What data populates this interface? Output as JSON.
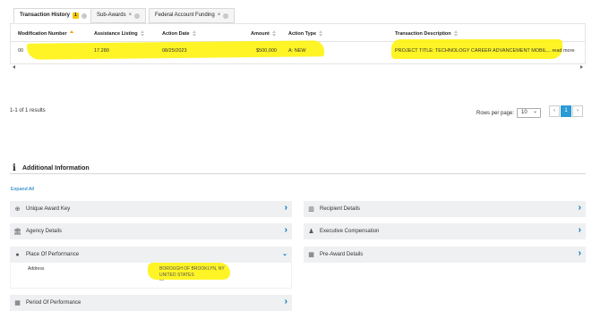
{
  "tabs": [
    {
      "label": "Transaction History",
      "badge": "1",
      "active": true
    },
    {
      "label": "Sub-Awards",
      "close": "×"
    },
    {
      "label": "Federal Account Funding",
      "close": "×"
    }
  ],
  "table": {
    "headers": [
      "Modification Number",
      "Assistance Listing",
      "Action Date",
      "Amount",
      "Action Type",
      "Transaction Description"
    ],
    "row": {
      "modification_number": "00",
      "assistance_listing": "17.280",
      "action_date": "08/25/2023",
      "amount": "$500,000",
      "action_type": "A: NEW",
      "description": "PROJECT TITLE: TECHNOLOGY CAREER ADVANCEMENT MOBIL...",
      "read_more": "read more"
    }
  },
  "pagination": {
    "results_text": "1-1 of 1 results",
    "rows_per_page_label": "Rows per page:",
    "rows_per_page_value": "10",
    "prev": "‹",
    "current_page": "1",
    "next": "›"
  },
  "additional_info": {
    "title": "Additional Information",
    "expand_all": "Expand All",
    "left_panels": [
      {
        "label": "Unique Award Key",
        "icon": "globe-icon",
        "state": "collapsed"
      },
      {
        "label": "Agency Details",
        "icon": "bank-icon",
        "state": "collapsed"
      },
      {
        "label": "Place Of Performance",
        "icon": "map-pin-icon",
        "state": "expanded"
      },
      {
        "label": "Period Of Performance",
        "icon": "calendar-icon",
        "state": "collapsed"
      }
    ],
    "right_panels": [
      {
        "label": "Recipient Details",
        "icon": "building-icon",
        "state": "collapsed"
      },
      {
        "label": "Executive Compensation",
        "icon": "people-icon",
        "state": "collapsed"
      },
      {
        "label": "Pre-Award Details",
        "icon": "calendar-icon",
        "state": "collapsed"
      }
    ],
    "place_of_performance": {
      "address_label": "Address",
      "address_line1": "BOROUGH OF BROOKLYN, NY",
      "address_line2": "UNITED STATES",
      "address_line3": "—"
    }
  },
  "colors": {
    "highlight": "#fff200",
    "link": "#0071bc",
    "accent": "#f59b00",
    "page_active": "#2b9bd3"
  }
}
